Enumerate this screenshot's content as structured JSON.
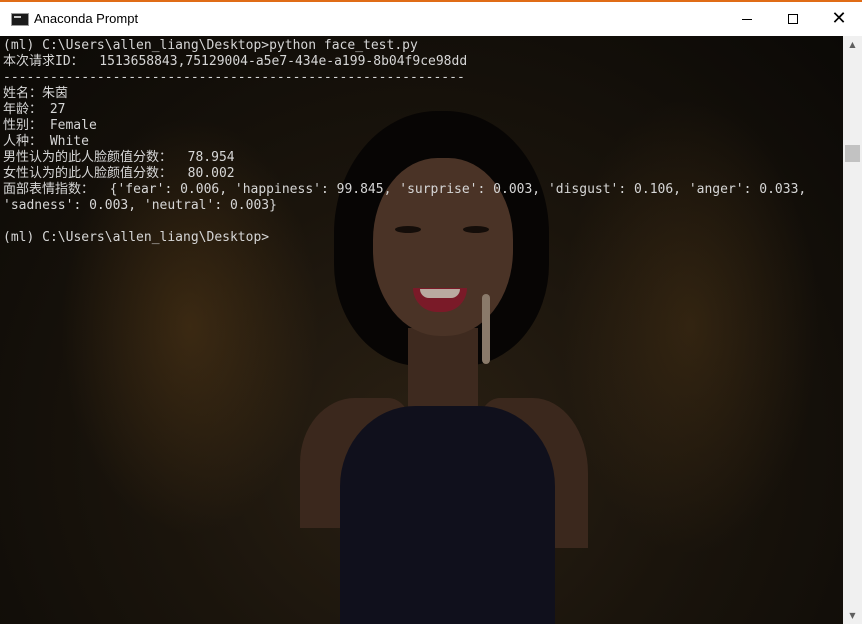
{
  "window": {
    "title": "Anaconda Prompt",
    "accent_color": "#e06c17",
    "icons": {
      "app": "console-icon",
      "minimize": "minimize-icon",
      "maximize": "maximize-icon",
      "close": "close-icon"
    }
  },
  "console": {
    "lines": [
      "(ml) C:\\Users\\allen_liang\\Desktop>python face_test.py",
      "本次请求ID：  1513658843,75129004-a5e7-434e-a199-8b04f9ce98dd",
      "-----------------------------------------------------------",
      "姓名：朱茵",
      "年龄： 27",
      "性别： Female",
      "人种： White",
      "男性认为的此人脸颜值分数：  78.954",
      "女性认为的此人脸颜值分数：  80.002",
      "面部表情指数：  {'fear': 0.006, 'happiness': 99.845, 'surprise': 0.003, 'disgust': 0.106, 'anger': 0.033,",
      "'sadness': 0.003, 'neutral': 0.003}",
      "",
      "(ml) C:\\Users\\allen_liang\\Desktop>"
    ],
    "text_color": "#d6d6d6",
    "background_image": "portrait-photo"
  },
  "scrollbar": {
    "up_icon": "▲",
    "down_icon": "▼"
  }
}
